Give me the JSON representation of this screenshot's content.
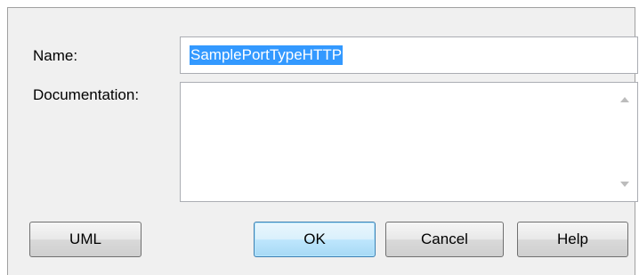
{
  "form": {
    "name_label": "Name:",
    "name_value": "SamplePortTypeHTTP",
    "documentation_label": "Documentation:",
    "documentation_value": ""
  },
  "buttons": {
    "uml": "UML",
    "ok": "OK",
    "cancel": "Cancel",
    "help": "Help"
  },
  "colors": {
    "selection": "#3399ff",
    "dialog_bg": "#f0f0f0",
    "default_button_border": "#3c7fb1"
  }
}
